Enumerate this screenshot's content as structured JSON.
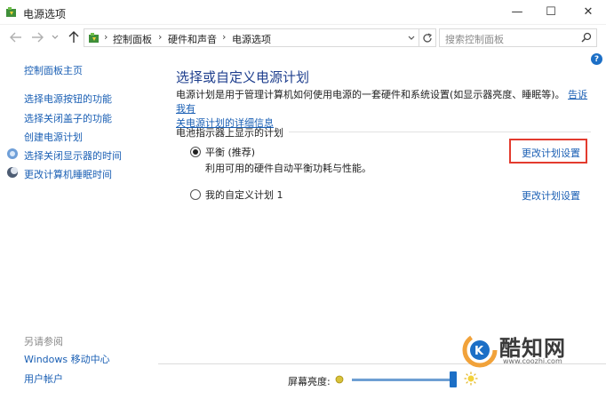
{
  "window": {
    "title": "电源选项",
    "controls": {
      "minimize": "—",
      "maximize": "☐",
      "close": "✕"
    }
  },
  "address_bar": {
    "breadcrumbs": [
      "控制面板",
      "硬件和声音",
      "电源选项"
    ],
    "separator": "›",
    "search_placeholder": "搜索控制面板"
  },
  "sidebar": {
    "home": "控制面板主页",
    "links": [
      "选择电源按钮的功能",
      "选择关闭盖子的功能",
      "创建电源计划",
      "选择关闭显示器的时间",
      "更改计算机睡眠时间"
    ],
    "see_also_title": "另请参阅",
    "see_also": [
      "Windows 移动中心",
      "用户帐户"
    ]
  },
  "main": {
    "heading": "选择或自定义电源计划",
    "description": "电源计划是用于管理计算机如何使用电源的一套硬件和系统设置(如显示器亮度、睡眠等)。",
    "description_link": "告诉我有关电源计划的详细信息",
    "description_link_part1": "告诉我有",
    "description_link_part2": "关电源计划的详细信息",
    "group_title": "电池指示器上显示的计划",
    "plans": [
      {
        "name": "平衡 (推荐)",
        "description": "利用可用的硬件自动平衡功耗与性能。",
        "change_link": "更改计划设置",
        "selected": true
      },
      {
        "name": "我的自定义计划 1",
        "description": "",
        "change_link": "更改计划设置",
        "selected": false
      }
    ]
  },
  "footer": {
    "brightness_label": "屏幕亮度:",
    "brightness_level": 0.97
  },
  "watermark": {
    "text": "酷知网",
    "url": "www.coozhi.com"
  },
  "colors": {
    "link": "#1a5fb4",
    "heading": "#1f3f8e",
    "highlight_box": "#e33b2e",
    "accent": "#1c6fc6"
  }
}
